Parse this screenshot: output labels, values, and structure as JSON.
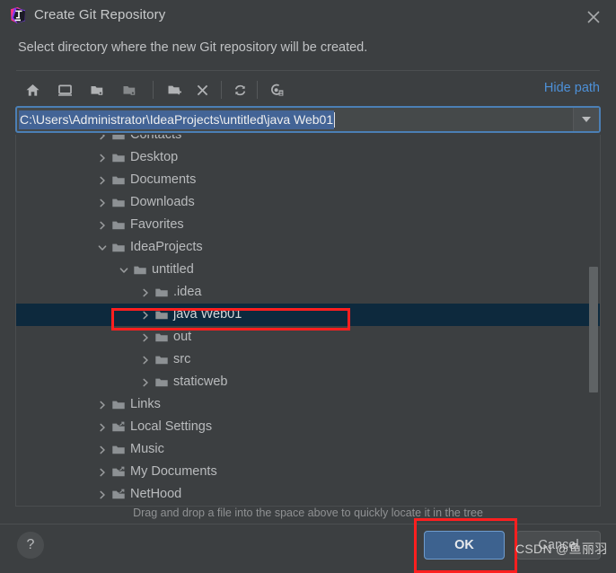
{
  "window": {
    "title": "Create Git Repository",
    "app_icon": "intellij-idea-logo",
    "close_icon": "close-icon"
  },
  "prompt": "Select directory where the new Git repository will be created.",
  "toolbar": {
    "hide_path_label": "Hide path",
    "buttons": [
      {
        "name": "home-icon",
        "tooltip": "Home"
      },
      {
        "name": "desktop-icon",
        "tooltip": "Desktop"
      },
      {
        "name": "project-folder-icon",
        "tooltip": "Project Directory"
      },
      {
        "name": "module-folder-icon",
        "tooltip": "Module Directory"
      },
      {
        "name": "new-folder-icon",
        "tooltip": "New Folder"
      },
      {
        "name": "delete-icon",
        "tooltip": "Delete"
      },
      {
        "name": "refresh-icon",
        "tooltip": "Refresh"
      },
      {
        "name": "show-hidden-files-icon",
        "tooltip": "Show Hidden Files and Directories"
      }
    ]
  },
  "path_field": {
    "value": "C:\\Users\\Administrator\\IdeaProjects\\untitled\\java Web01",
    "selected": true,
    "dropdown_icon": "chevron-down-icon"
  },
  "tree": {
    "items": [
      {
        "label": "Contacts",
        "depth": 0,
        "expanded": false,
        "icon": "folder-icon",
        "selected": false
      },
      {
        "label": "Desktop",
        "depth": 0,
        "expanded": false,
        "icon": "folder-icon",
        "selected": false
      },
      {
        "label": "Documents",
        "depth": 0,
        "expanded": false,
        "icon": "folder-icon",
        "selected": false
      },
      {
        "label": "Downloads",
        "depth": 0,
        "expanded": false,
        "icon": "folder-icon",
        "selected": false
      },
      {
        "label": "Favorites",
        "depth": 0,
        "expanded": false,
        "icon": "folder-icon",
        "selected": false
      },
      {
        "label": "IdeaProjects",
        "depth": 0,
        "expanded": true,
        "icon": "folder-icon",
        "selected": false
      },
      {
        "label": "untitled",
        "depth": 1,
        "expanded": true,
        "icon": "folder-icon",
        "selected": false
      },
      {
        "label": ".idea",
        "depth": 2,
        "expanded": false,
        "icon": "folder-icon",
        "selected": false
      },
      {
        "label": "java Web01",
        "depth": 2,
        "expanded": false,
        "icon": "folder-icon",
        "selected": true
      },
      {
        "label": "out",
        "depth": 2,
        "expanded": false,
        "icon": "folder-icon",
        "selected": false
      },
      {
        "label": "src",
        "depth": 2,
        "expanded": false,
        "icon": "folder-icon",
        "selected": false
      },
      {
        "label": "staticweb",
        "depth": 2,
        "expanded": false,
        "icon": "folder-icon",
        "selected": false
      },
      {
        "label": "Links",
        "depth": 0,
        "expanded": false,
        "icon": "folder-icon",
        "selected": false
      },
      {
        "label": "Local Settings",
        "depth": 0,
        "expanded": false,
        "icon": "folder-shortcut-icon",
        "selected": false
      },
      {
        "label": "Music",
        "depth": 0,
        "expanded": false,
        "icon": "folder-icon",
        "selected": false
      },
      {
        "label": "My Documents",
        "depth": 0,
        "expanded": false,
        "icon": "folder-shortcut-icon",
        "selected": false
      },
      {
        "label": "NetHood",
        "depth": 0,
        "expanded": false,
        "icon": "folder-shortcut-icon",
        "selected": false
      }
    ],
    "scrollbar": {
      "name": "vertical-scrollbar"
    }
  },
  "hint": "Drag and drop a file into the space above to quickly locate it in the tree",
  "footer": {
    "help_label": "?",
    "ok_label": "OK",
    "cancel_label": "Cancel"
  },
  "watermark": "CSDN @鱼丽羽",
  "colors": {
    "dialog_bg": "#3c3f41",
    "accent_blue": "#4d90d8",
    "selection_row": "#0d293d",
    "text_selection": "#436496",
    "ok_button": "#3d628f",
    "annotation_red": "#ff1f1f"
  },
  "annotations": [
    {
      "name": "selected-folder-highlight"
    },
    {
      "name": "ok-button-highlight"
    }
  ]
}
